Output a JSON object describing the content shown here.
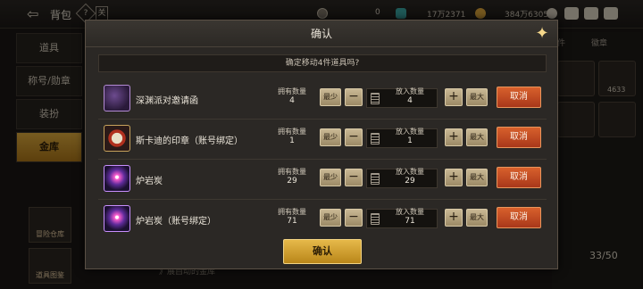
{
  "topbar": {
    "title": "背包",
    "help_glyph": "?",
    "chat_glyph": "关",
    "currency_1": "0",
    "currency_2": "17万2371",
    "currency_3": "384万6305"
  },
  "left_nav": {
    "items": [
      {
        "label": "道具"
      },
      {
        "label": "称号/勋章"
      },
      {
        "label": "装扮"
      },
      {
        "label": "金库"
      }
    ],
    "side_buttons": [
      {
        "label": "冒险仓库"
      },
      {
        "label": "道具图鉴"
      }
    ]
  },
  "right_panel": {
    "tab_1": "件",
    "tab_2": "徽章",
    "slot_count": "4633",
    "capacity": "33/50"
  },
  "background": {
    "bottom_text": "》展自动的金库"
  },
  "dialog": {
    "title": "确认",
    "subheader": "确定移动4件道具吗?",
    "owned_label": "拥有数量",
    "put_label": "放入数量",
    "min_label": "最少",
    "max_label": "最大",
    "cancel_label": "取消",
    "confirm_label": "确认",
    "items": [
      {
        "name": "深渊派对邀请函",
        "owned": "4",
        "put": "4",
        "icon": "invitation-icon"
      },
      {
        "name": "斯卡迪的印章（账号绑定）",
        "owned": "1",
        "put": "1",
        "icon": "seal-icon"
      },
      {
        "name": "炉岩炭",
        "owned": "29",
        "put": "29",
        "icon": "crystal-orb-icon"
      },
      {
        "name": "炉岩炭（账号绑定）",
        "owned": "71",
        "put": "71",
        "icon": "crystal-orb-icon"
      }
    ]
  }
}
